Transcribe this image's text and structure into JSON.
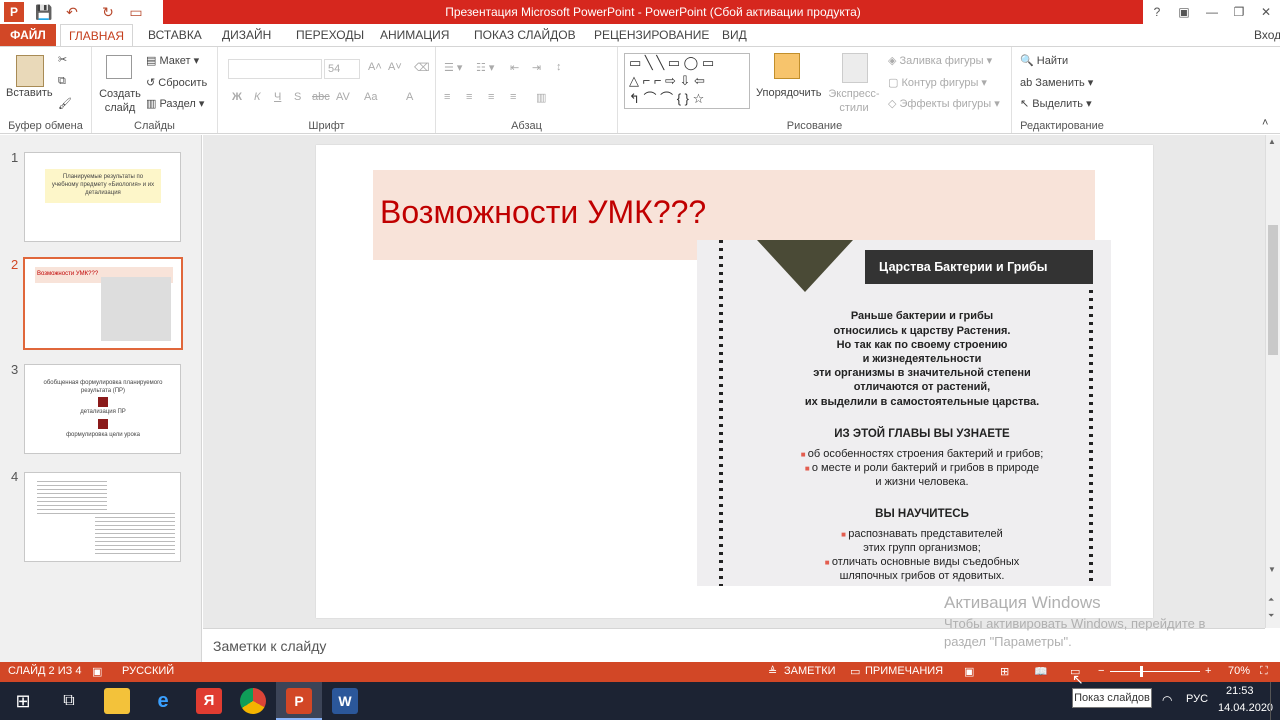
{
  "window": {
    "title": "Презентация Microsoft PowerPoint -  PowerPoint (Сбой активации продукта)",
    "help": "?",
    "login": "Вход"
  },
  "tabs": [
    "ФАЙЛ",
    "ГЛАВНАЯ",
    "ВСТАВКА",
    "ДИЗАЙН",
    "ПЕРЕХОДЫ",
    "АНИМАЦИЯ",
    "ПОКАЗ СЛАЙДОВ",
    "РЕЦЕНЗИРОВАНИЕ",
    "ВИД"
  ],
  "ribbon": {
    "clipboard": {
      "paste": "Вставить",
      "label": "Буфер обмена"
    },
    "slides": {
      "new_slide": "Создать слайд",
      "layout": "Макет",
      "reset": "Сбросить",
      "section": "Раздел",
      "label": "Слайды"
    },
    "font": {
      "size": "54",
      "bold": "Ж",
      "italic": "К",
      "underline": "Ч",
      "strike": "S",
      "abc": "abc",
      "aa": "Aa",
      "label": "Шрифт"
    },
    "paragraph": {
      "label": "Абзац"
    },
    "drawing": {
      "arrange": "Упорядочить",
      "quick_styles": "Экспресс-стили",
      "fill": "Заливка фигуры",
      "outline": "Контур фигуры",
      "effects": "Эффекты фигуры",
      "label": "Рисование"
    },
    "editing": {
      "find": "Найти",
      "replace": "Заменить",
      "select": "Выделить",
      "label": "Редактирование"
    }
  },
  "thumbnails": [
    {
      "num": "1",
      "text": "Планируемые результаты по учебному предмету «Биология» и их детализация"
    },
    {
      "num": "2",
      "text": "Возможности УМК???"
    },
    {
      "num": "3",
      "lines": [
        "обобщенная формулировка планируемого результата (ПР)",
        "детализация ПР",
        "формулировка цели урока"
      ]
    },
    {
      "num": "4"
    }
  ],
  "slide": {
    "title": "Возможности УМК???",
    "picture": {
      "header": "Царства Бактерии и Грибы",
      "intro": [
        "Раньше бактерии и грибы",
        "относились к царству Растения.",
        "Но так как по своему строению",
        "и жизнедеятельности",
        "эти организмы в значительной степени",
        "отличаются от растений,",
        "их выделили в самостоятельные царства."
      ],
      "section1": "ИЗ ЭТОЙ ГЛАВЫ ВЫ УЗНАЕТЕ",
      "items1": [
        "об особенностях строения бактерий и грибов;",
        "о месте и роли бактерий и грибов в природе",
        "и жизни человека."
      ],
      "section2": "ВЫ НАУЧИТЕСЬ",
      "items2": [
        "распознавать представителей",
        "этих групп организмов;",
        "отличать основные виды съедобных",
        "шляпочных грибов от ядовитых."
      ]
    }
  },
  "notes_placeholder": "Заметки к слайду",
  "watermark": {
    "title": "Активация Windows",
    "line1": "Чтобы активировать Windows, перейдите в",
    "line2": "раздел \"Параметры\"."
  },
  "status": {
    "slide": "СЛАЙД 2 ИЗ 4",
    "language": "РУССКИЙ",
    "notes": "ЗАМЕТКИ",
    "comments": "ПРИМЕЧАНИЯ",
    "zoom": "70%"
  },
  "tooltip": "Показ слайдов",
  "taskbar": {
    "lang": "РУС",
    "time": "21:53",
    "date": "14.04.2020"
  },
  "colors": {
    "accent": "#d24726",
    "title_red": "#c00000",
    "title_bg": "#f8e3d9"
  }
}
